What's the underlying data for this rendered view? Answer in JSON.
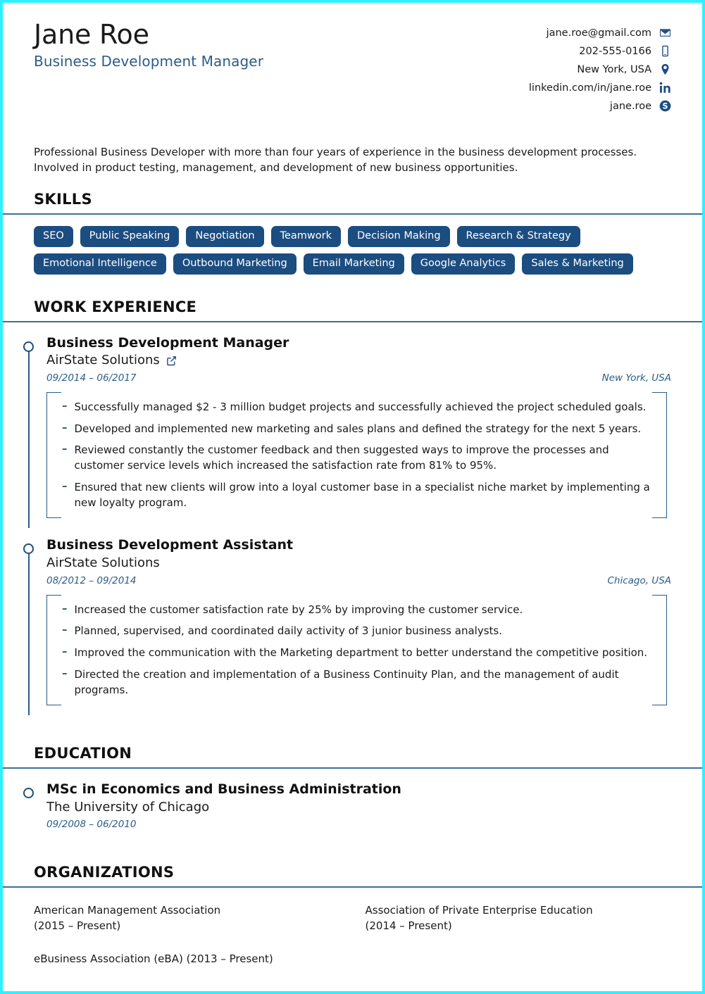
{
  "header": {
    "name": "Jane Roe",
    "job_title": "Business Development Manager",
    "contacts": [
      {
        "value": "jane.roe@gmail.com",
        "icon": "email-icon"
      },
      {
        "value": "202-555-0166",
        "icon": "phone-icon"
      },
      {
        "value": "New York, USA",
        "icon": "location-pin-icon"
      },
      {
        "value": "linkedin.com/in/jane.roe",
        "icon": "linkedin-icon"
      },
      {
        "value": "jane.roe",
        "icon": "skype-icon"
      }
    ]
  },
  "summary": "Professional Business Developer with more than four years of experience in the business development processes. Involved in product testing, management, and development of new business opportunities.",
  "sections": {
    "skills_title": "SKILLS",
    "work_title": "WORK EXPERIENCE",
    "education_title": "EDUCATION",
    "organizations_title": "ORGANIZATIONS"
  },
  "skills": {
    "row1": [
      "SEO",
      "Public Speaking",
      "Negotiation",
      "Teamwork",
      "Decision Making",
      "Research & Strategy"
    ],
    "row2": [
      "Emotional Intelligence",
      "Outbound Marketing",
      "Email Marketing",
      "Google Analytics",
      "Sales & Marketing"
    ]
  },
  "work": [
    {
      "title": "Business Development Manager",
      "company": "AirState Solutions",
      "has_link": true,
      "dates": "09/2014 – 06/2017",
      "location": "New York, USA",
      "bullets": [
        "Successfully managed $2 - 3 million budget projects and successfully achieved the project scheduled goals.",
        "Developed and implemented new marketing and sales plans and defined the strategy for the next 5 years.",
        "Reviewed constantly the customer feedback and then suggested ways to improve the processes and customer service levels which increased the satisfaction rate from 81% to 95%.",
        "Ensured that new clients will grow into a loyal customer base in a specialist niche market by implementing a new loyalty program."
      ]
    },
    {
      "title": "Business Development Assistant",
      "company": "AirState Solutions",
      "has_link": false,
      "dates": "08/2012 – 09/2014",
      "location": "Chicago, USA",
      "bullets": [
        "Increased the customer satisfaction rate by 25% by improving the customer service.",
        "Planned, supervised, and coordinated daily activity of 3 junior business analysts.",
        "Improved the communication with the Marketing department to better understand the competitive position.",
        "Directed the creation and implementation of a Business Continuity Plan, and the management of audit programs."
      ]
    }
  ],
  "education": [
    {
      "degree": "MSc in Economics and Business Administration",
      "school": "The University of Chicago",
      "dates": "09/2008 – 06/2010"
    }
  ],
  "organizations": [
    "American Management Association\n(2015 – Present)",
    "Association of Private Enterprise Education\n(2014 – Present)",
    "eBusiness Association (eBA) (2013 – Present)"
  ],
  "colors": {
    "accent_border": "#2ef0ff",
    "tag_bg": "#1c4d80",
    "rule": "#3f6f95",
    "link_blue": "#2a5d87"
  }
}
